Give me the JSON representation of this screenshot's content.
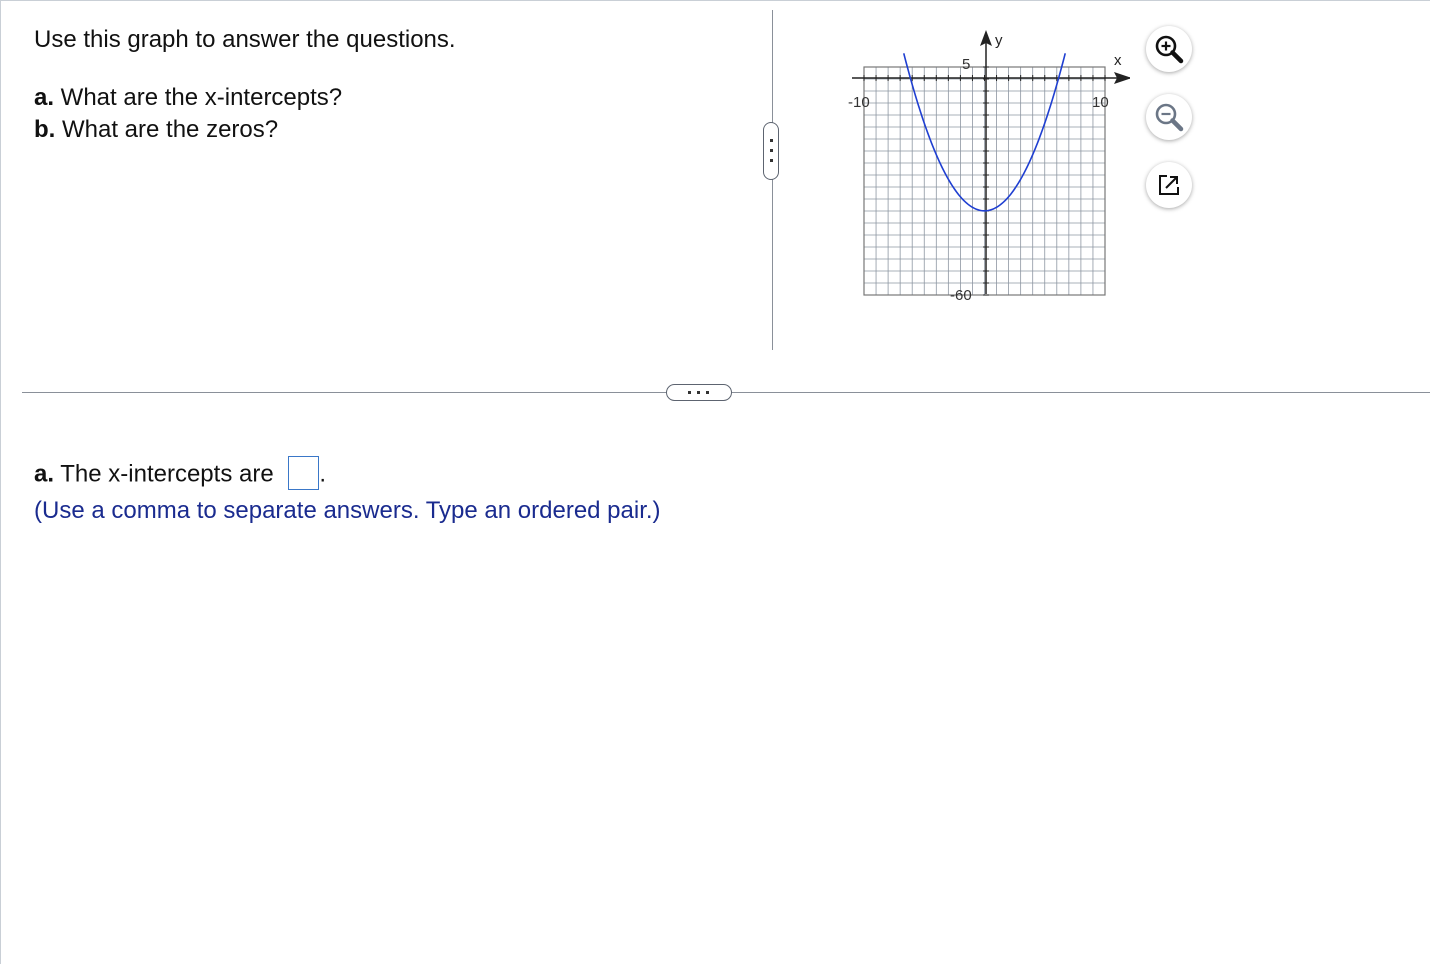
{
  "question": {
    "intro": "Use this graph to answer the questions.",
    "part_a_label": "a.",
    "part_a_text": " What are the x-intercepts?",
    "part_b_label": "b.",
    "part_b_text": " What are the zeros?"
  },
  "graph": {
    "x_axis_label": "x",
    "y_axis_label": "y",
    "x_min_label": "-10",
    "x_max_label": "10",
    "y_max_label": "5",
    "y_min_label": "-60",
    "x_range": [
      -10,
      10
    ],
    "y_range": [
      -60,
      5
    ],
    "curve_color": "#1f3fd1"
  },
  "tools": {
    "zoom_in": "zoom-in-icon",
    "zoom_out": "zoom-out-icon",
    "popout": "popout-icon"
  },
  "answer": {
    "label": "a.",
    "text": " The x-intercepts are ",
    "input_value": "",
    "suffix": ".",
    "hint": "(Use a comma to separate answers. Type an ordered pair.)"
  }
}
